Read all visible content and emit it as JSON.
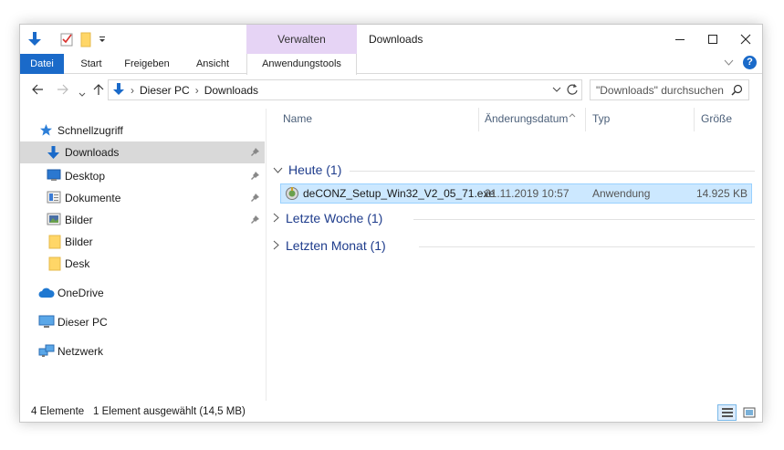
{
  "window": {
    "title": "Downloads",
    "contextual_group": "Verwalten",
    "buttons": [
      "minimize",
      "maximize",
      "close"
    ]
  },
  "ribbon": {
    "tabs": [
      {
        "label": "Datei"
      },
      {
        "label": "Start"
      },
      {
        "label": "Freigeben"
      },
      {
        "label": "Ansicht"
      },
      {
        "label": "Anwendungstools"
      }
    ]
  },
  "address": {
    "breadcrumbs": [
      "Dieser PC",
      "Downloads"
    ],
    "search_placeholder": "\"Downloads\" durchsuchen"
  },
  "sidebar": {
    "items": [
      {
        "label": "Schnellzugriff",
        "icon": "star-icon"
      },
      {
        "label": "Downloads",
        "icon": "download-folder-icon",
        "pinned": true,
        "selected": true
      },
      {
        "label": "Desktop",
        "icon": "desktop-icon",
        "pinned": true
      },
      {
        "label": "Dokumente",
        "icon": "documents-icon",
        "pinned": true
      },
      {
        "label": "Bilder",
        "icon": "pictures-icon",
        "pinned": true
      },
      {
        "label": "Bilder",
        "icon": "folder-icon"
      },
      {
        "label": "Desk",
        "icon": "folder-icon"
      },
      {
        "label": "OneDrive",
        "icon": "cloud-icon"
      },
      {
        "label": "Dieser PC",
        "icon": "computer-icon"
      },
      {
        "label": "Netzwerk",
        "icon": "network-icon"
      }
    ]
  },
  "columns": [
    "Name",
    "Änderungsdatum",
    "Typ",
    "Größe"
  ],
  "groups": [
    {
      "label": "Heute (1)",
      "expanded": true
    },
    {
      "label": "Letzte Woche (1)",
      "expanded": false
    },
    {
      "label": "Letzten Monat (1)",
      "expanded": false
    }
  ],
  "files": [
    {
      "name": "deCONZ_Setup_Win32_V2_05_71.exe",
      "date": "21.11.2019 10:57",
      "type": "Anwendung",
      "size": "14.925 KB",
      "selected": true
    }
  ],
  "status": {
    "count": "4 Elemente",
    "selection": "1 Element ausgewählt (14,5 MB)"
  },
  "colors": {
    "accent": "#1a6ac9",
    "contextual_tab": "#e6d4f5",
    "selection_bg": "#cce8ff",
    "selection_border": "#99d1ff",
    "group_text": "#1e3c8c"
  }
}
